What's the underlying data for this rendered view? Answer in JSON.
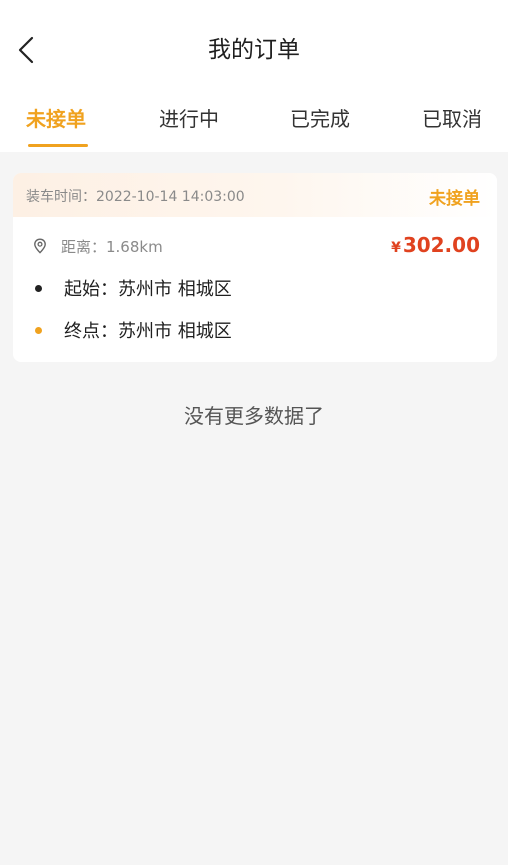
{
  "header": {
    "title": "我的订单",
    "back_icon": "chevron-left-icon"
  },
  "tabs": [
    {
      "label": "未接单",
      "active": true
    },
    {
      "label": "进行中",
      "active": false
    },
    {
      "label": "已完成",
      "active": false
    },
    {
      "label": "已取消",
      "active": false
    }
  ],
  "orders": [
    {
      "load_time": "装车时间：2022-10-14 14:03:00",
      "status": "未接单",
      "distance": "距离：1.68km",
      "distance_icon": "location-pin-icon",
      "price_currency": "¥",
      "price": "302.00",
      "origin": "起始：苏州市 相城区",
      "destination": "终点：苏州市 相城区"
    }
  ],
  "footer_note": "没有更多数据了",
  "colors": {
    "accent": "#f0a21f",
    "price": "#e0421f",
    "origin_dot": "#222222",
    "destination_dot": "#f0a21f"
  }
}
